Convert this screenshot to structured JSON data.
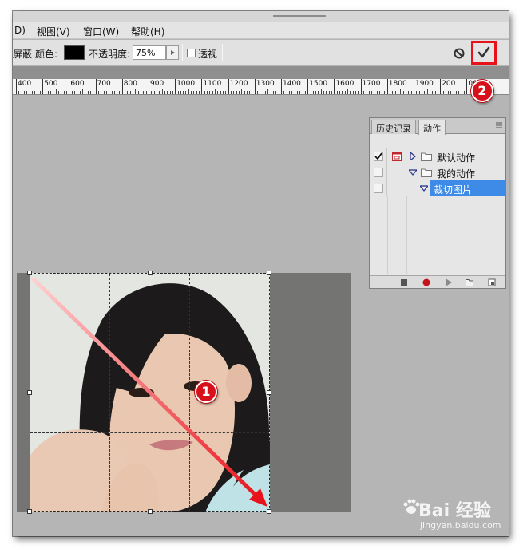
{
  "menu": {
    "items": [
      "D)",
      "视图(V)",
      "窗口(W)",
      "帮助(H)"
    ]
  },
  "options": {
    "shield_label": "屏蔽",
    "color_label": "颜色:",
    "color_value": "#000000",
    "opacity_label": "不透明度:",
    "opacity_value": "75%",
    "perspective_label": "透视"
  },
  "ruler": {
    "labels": [
      "400",
      "500",
      "600",
      "700",
      "800",
      "900",
      "1000",
      "1100",
      "1200",
      "1300",
      "1400",
      "1500",
      "1600",
      "1700",
      "1800",
      "1900",
      "200",
      "00"
    ]
  },
  "actions_panel": {
    "tabs": [
      "历史记录",
      "动作"
    ],
    "rows": [
      {
        "label": "默认动作",
        "checked": true,
        "expanded": false,
        "selected": false
      },
      {
        "label": "我的动作",
        "checked": false,
        "expanded": true,
        "selected": false
      },
      {
        "label": "裁切图片",
        "checked": false,
        "expanded": true,
        "selected": true
      }
    ]
  },
  "annotations": {
    "step1": "1",
    "step2": "2"
  },
  "watermark": {
    "brand": "Bai 经验",
    "url": "jingyan.baidu.com"
  },
  "colors": {
    "accent_red": "#e8131a",
    "selection_blue": "#3d8be6"
  }
}
